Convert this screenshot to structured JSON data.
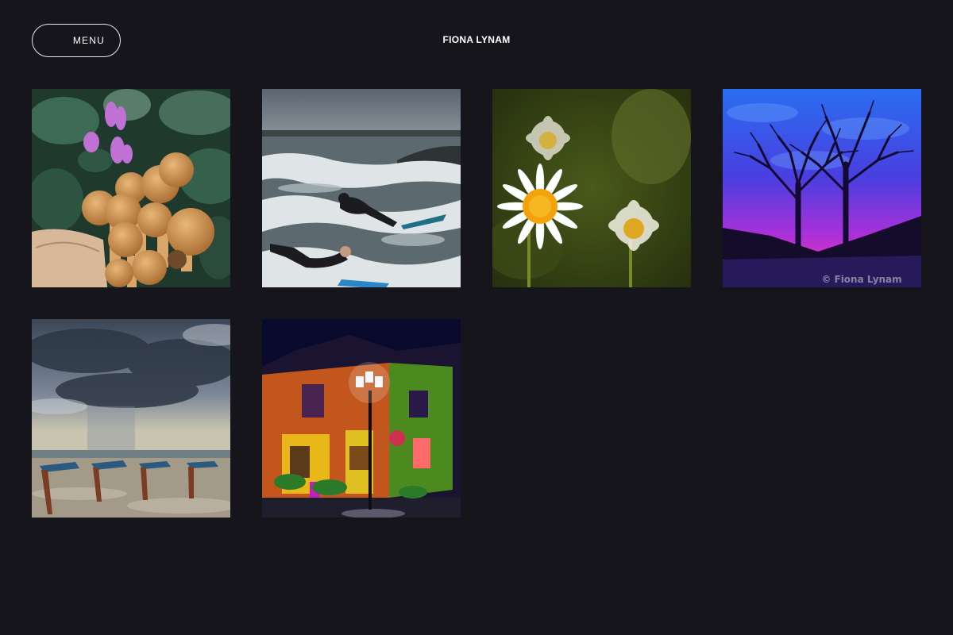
{
  "header": {
    "menu_label": "MENU",
    "site_title": "FIONA LYNAM"
  },
  "gallery": {
    "items": [
      {
        "subject": "mushrooms-cyclamen"
      },
      {
        "subject": "surfers-waves"
      },
      {
        "subject": "daisies"
      },
      {
        "subject": "silhouette-trees",
        "watermark": "© Fiona Lynam"
      },
      {
        "subject": "storm-beach-signs"
      },
      {
        "subject": "village-street-night"
      }
    ]
  },
  "colors": {
    "background": "#16151b",
    "text": "#ffffff",
    "menu_border": "#e8e8ea"
  }
}
